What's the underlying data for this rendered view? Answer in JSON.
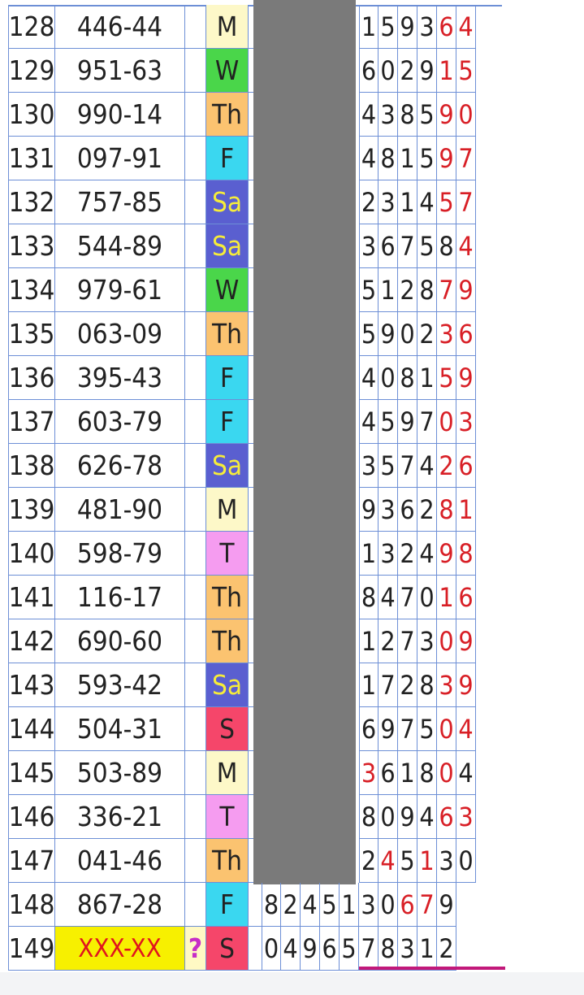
{
  "rows": [
    {
      "num": "128",
      "result": "446-44",
      "day": "M",
      "digits": [
        "1",
        "5",
        "9",
        "3",
        "6",
        "4"
      ],
      "red": [
        4,
        5
      ]
    },
    {
      "num": "129",
      "result": "951-63",
      "day": "W",
      "digits": [
        "6",
        "0",
        "2",
        "9",
        "1",
        "5"
      ],
      "red": [
        4,
        5
      ]
    },
    {
      "num": "130",
      "result": "990-14",
      "day": "Th",
      "digits": [
        "4",
        "3",
        "8",
        "5",
        "9",
        "0"
      ],
      "red": [
        4,
        5
      ]
    },
    {
      "num": "131",
      "result": "097-91",
      "day": "F",
      "digits": [
        "4",
        "8",
        "1",
        "5",
        "9",
        "7"
      ],
      "red": [
        4,
        5
      ]
    },
    {
      "num": "132",
      "result": "757-85",
      "day": "Sa",
      "digits": [
        "2",
        "3",
        "1",
        "4",
        "5",
        "7"
      ],
      "red": [
        4,
        5
      ]
    },
    {
      "num": "133",
      "result": "544-89",
      "day": "Sa",
      "digits": [
        "3",
        "6",
        "7",
        "5",
        "8",
        "4"
      ],
      "red": [
        5
      ]
    },
    {
      "num": "134",
      "result": "979-61",
      "day": "W",
      "digits": [
        "5",
        "1",
        "2",
        "8",
        "7",
        "9"
      ],
      "red": [
        4,
        5
      ]
    },
    {
      "num": "135",
      "result": "063-09",
      "day": "Th",
      "digits": [
        "5",
        "9",
        "0",
        "2",
        "3",
        "6"
      ],
      "red": [
        4,
        5
      ]
    },
    {
      "num": "136",
      "result": "395-43",
      "day": "F",
      "digits": [
        "4",
        "0",
        "8",
        "1",
        "5",
        "9"
      ],
      "red": [
        4,
        5
      ]
    },
    {
      "num": "137",
      "result": "603-79",
      "day": "F",
      "digits": [
        "4",
        "5",
        "9",
        "7",
        "0",
        "3"
      ],
      "red": [
        4,
        5
      ]
    },
    {
      "num": "138",
      "result": "626-78",
      "day": "Sa",
      "digits": [
        "3",
        "5",
        "7",
        "4",
        "2",
        "6"
      ],
      "red": [
        4,
        5
      ]
    },
    {
      "num": "139",
      "result": "481-90",
      "day": "M",
      "digits": [
        "9",
        "3",
        "6",
        "2",
        "8",
        "1"
      ],
      "red": [
        4,
        5
      ]
    },
    {
      "num": "140",
      "result": "598-79",
      "day": "T",
      "digits": [
        "1",
        "3",
        "2",
        "4",
        "9",
        "8"
      ],
      "red": [
        4,
        5
      ]
    },
    {
      "num": "141",
      "result": "116-17",
      "day": "Th",
      "digits": [
        "8",
        "4",
        "7",
        "0",
        "1",
        "6"
      ],
      "red": [
        4,
        5
      ]
    },
    {
      "num": "142",
      "result": "690-60",
      "day": "Th",
      "digits": [
        "1",
        "2",
        "7",
        "3",
        "0",
        "9"
      ],
      "red": [
        4,
        5
      ]
    },
    {
      "num": "143",
      "result": "593-42",
      "day": "Sa",
      "digits": [
        "1",
        "7",
        "2",
        "8",
        "3",
        "9"
      ],
      "red": [
        4,
        5
      ]
    },
    {
      "num": "144",
      "result": "504-31",
      "day": "S",
      "digits": [
        "6",
        "9",
        "7",
        "5",
        "0",
        "4"
      ],
      "red": [
        4,
        5
      ]
    },
    {
      "num": "145",
      "result": "503-89",
      "day": "M",
      "digits": [
        "3",
        "6",
        "1",
        "8",
        "0",
        "4"
      ],
      "red": [
        0,
        4
      ]
    },
    {
      "num": "146",
      "result": "336-21",
      "day": "T",
      "digits": [
        "8",
        "0",
        "9",
        "4",
        "6",
        "3"
      ],
      "red": [
        4,
        5
      ]
    },
    {
      "num": "147",
      "result": "041-46",
      "day": "Th",
      "digits": [
        "2",
        "4",
        "5",
        "1",
        "3",
        "0"
      ],
      "red": [
        1,
        3
      ]
    }
  ],
  "row148": {
    "num": "148",
    "result": "867-28",
    "day": "F",
    "digits": [
      "8",
      "2",
      "4",
      "5",
      "1",
      "3",
      "0",
      "6",
      "7",
      "9"
    ],
    "red": [
      7,
      8
    ]
  },
  "row149": {
    "num": "149",
    "result": "XXX-XX",
    "question": "?",
    "day": "S",
    "digits": [
      "0",
      "4",
      "9",
      "6",
      "5",
      "7",
      "8",
      "3",
      "1",
      "2"
    ],
    "red": []
  },
  "colors": {
    "grid": "#6d8fd6",
    "red_digit": "#d81f26",
    "placeholder_bg": "#f7f000",
    "underline": "#c2187a",
    "gray_block": "#7a7a7a"
  },
  "day_colors": {
    "M": "#fdf8c8",
    "W": "#4ad64a",
    "Th": "#fbc370",
    "F": "#3ad7f0",
    "Sa": "#5a5fd0",
    "T": "#f59cf0",
    "S": "#f5466a"
  }
}
